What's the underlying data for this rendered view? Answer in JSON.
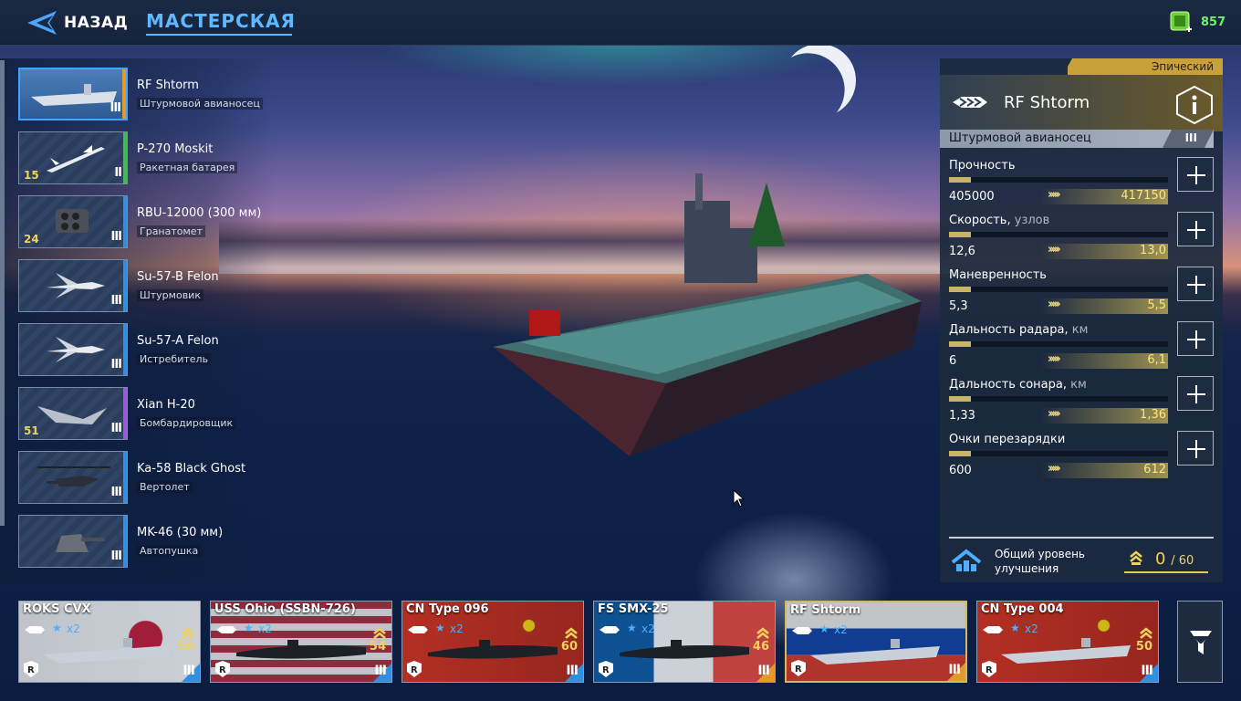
{
  "topbar": {
    "back_label": "НАЗАД",
    "title": "МАСТЕРСКАЯ",
    "currency_value": "857"
  },
  "colors": {
    "accent": "#5fb7ff",
    "currency": "#6ff06a",
    "epic": "#c8a13a",
    "tier_blue": "#2f8fe0",
    "tier_green": "#3fbf4a",
    "tier_purple": "#9a5ad8",
    "tier_orange": "#e39a2a",
    "gold": "#f0d25a"
  },
  "modules": [
    {
      "name": "RF Shtorm",
      "type": "Штурмовой авианосец",
      "tier": "III",
      "level": "",
      "icon": "carrier-icon",
      "selected": true
    },
    {
      "name": "P-270 Moskit",
      "type": "Ракетная батарея",
      "tier": "II",
      "level": "15",
      "icon": "missile-icon"
    },
    {
      "name": "RBU-12000 (300 мм)",
      "type": "Гранатомет",
      "tier": "III",
      "level": "24",
      "icon": "launcher-icon"
    },
    {
      "name": "Su-57-B Felon",
      "type": "Штурмовик",
      "tier": "III",
      "level": "",
      "icon": "jet-icon"
    },
    {
      "name": "Su-57-A Felon",
      "type": "Истребитель",
      "tier": "III",
      "level": "",
      "icon": "jet-icon"
    },
    {
      "name": "Xian H-20",
      "type": "Бомбардировщик",
      "tier": "III",
      "level": "51",
      "icon": "bomber-icon"
    },
    {
      "name": "Ka-58 Black Ghost",
      "type": "Вертолет",
      "tier": "III",
      "level": "",
      "icon": "helicopter-icon"
    },
    {
      "name": "MK-46 (30 мм)",
      "type": "Автопушка",
      "tier": "III",
      "level": "",
      "icon": "turret-icon"
    }
  ],
  "detail": {
    "rarity": "Эпический",
    "name": "RF Shtorm",
    "type": "Штурмовой авианосец",
    "tier": "III",
    "stats": [
      {
        "label": "Прочность",
        "unit": "",
        "current": "405000",
        "next": "417150",
        "fill": 0.1
      },
      {
        "label": "Скорость,",
        "unit": "узлов",
        "current": "12,6",
        "next": "13,0",
        "fill": 0.1
      },
      {
        "label": "Маневренность",
        "unit": "",
        "current": "5,3",
        "next": "5,5",
        "fill": 0.1
      },
      {
        "label": "Дальность радара,",
        "unit": "км",
        "current": "6",
        "next": "6,1",
        "fill": 0.1
      },
      {
        "label": "Дальность сонара,",
        "unit": "км",
        "current": "1,33",
        "next": "1,36",
        "fill": 0.1
      },
      {
        "label": "Очки перезарядки",
        "unit": "",
        "current": "600",
        "next": "612",
        "fill": 0.1
      }
    ],
    "upgrade_label": "Общий уровень улучшения",
    "upgrade_value": "0",
    "upgrade_max": "/ 60"
  },
  "ships": [
    {
      "name": "ROKS CVX",
      "mult": "x2",
      "level": "50",
      "tier": "III",
      "flag": "kr",
      "class": "carrier"
    },
    {
      "name": "USS Ohio (SSBN-726)",
      "mult": "x2",
      "level": "54",
      "tier": "III",
      "flag": "us",
      "class": "submarine"
    },
    {
      "name": "CN Type 096",
      "mult": "x2",
      "level": "60",
      "tier": "III",
      "flag": "cn",
      "class": "submarine"
    },
    {
      "name": "FS SMX-25",
      "mult": "x2",
      "level": "46",
      "tier": "III",
      "flag": "fr",
      "class": "submarine"
    },
    {
      "name": "RF Shtorm",
      "mult": "x2",
      "level": "",
      "tier": "III",
      "flag": "ru",
      "class": "carrier",
      "selected": true
    },
    {
      "name": "CN Type 004",
      "mult": "x2",
      "level": "50",
      "tier": "III",
      "flag": "cn",
      "class": "carrier"
    }
  ]
}
